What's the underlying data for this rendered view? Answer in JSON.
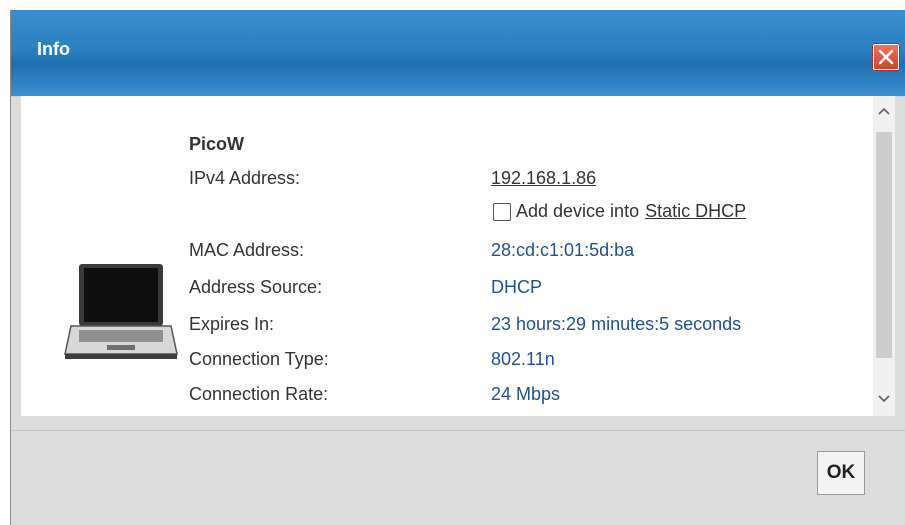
{
  "dialog": {
    "title": "Info",
    "close_icon": "close-icon"
  },
  "device": {
    "icon": "laptop-icon",
    "name": "PicoW"
  },
  "fields": {
    "ipv4_label": "IPv4 Address:",
    "ipv4_value": "192.168.1.86",
    "static_dhcp_prefix": "Add device into",
    "static_dhcp_link": "Static DHCP",
    "static_dhcp_checked": false,
    "mac_label": "MAC Address:",
    "mac_value": "28:cd:c1:01:5d:ba",
    "source_label": "Address Source:",
    "source_value": "DHCP",
    "expires_label": "Expires In:",
    "expires_value": "23 hours:29 minutes:5 seconds",
    "conn_type_label": "Connection Type:",
    "conn_type_value": "802.11n",
    "conn_rate_label": "Connection Rate:",
    "conn_rate_value": "24 Mbps"
  },
  "scrollbar": {
    "up_icon": "chevron-up-icon",
    "down_icon": "chevron-down-icon",
    "up_glyph": "^",
    "down_glyph": "v"
  },
  "footer": {
    "ok_label": "OK"
  },
  "colors": {
    "title_bar": "#2a7fc2",
    "value_text": "#1f4f9a",
    "close_button": "#d2402a"
  }
}
